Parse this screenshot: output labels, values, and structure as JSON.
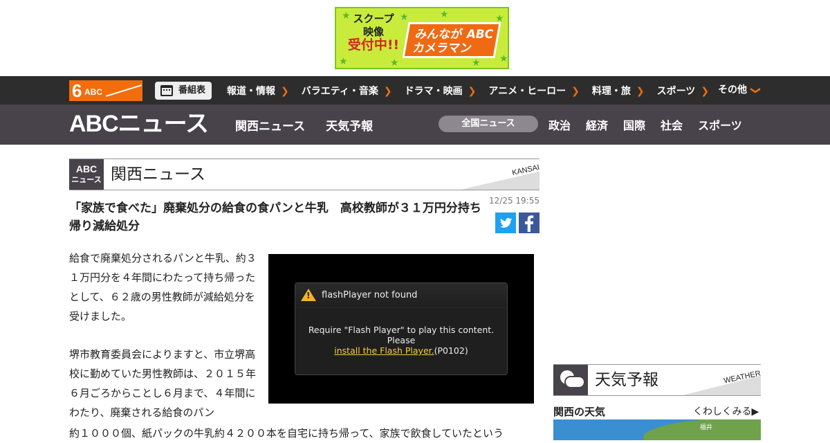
{
  "ad": {
    "left_lines": [
      "スクープ",
      "映像",
      "受付中!!"
    ],
    "logo_lines": [
      "みんなが ABC",
      "カメラマン"
    ],
    "colors": {
      "bg": "#c9ec3c",
      "logo": "#ef6a12"
    }
  },
  "topnav": {
    "logo_six": "6",
    "logo_text": "ABC",
    "program_guide": "番組表",
    "links": [
      "報道・情報",
      "バラエティ・音楽",
      "ドラマ・映画",
      "アニメ・ヒーロー",
      "料理・旅",
      "スポーツ"
    ],
    "more": "その他",
    "accent": "#f26d0c"
  },
  "sitebar": {
    "logo": "ABCニュース",
    "links": [
      "関西ニュース",
      "天気予報"
    ],
    "national": "全国ニュース",
    "categories": [
      "政治",
      "経済",
      "国際",
      "社会",
      "スポーツ"
    ]
  },
  "section": {
    "badge_top": "ABC",
    "badge_bottom": "ニュース",
    "title": "関西ニュース",
    "label": "KANSAI"
  },
  "article": {
    "title": "「家族で食べた」廃棄処分の給食の食パンと牛乳　高校教師が３１万円分持ち帰り減給処分",
    "timestamp": "12/25 19:55",
    "paragraphs": [
      "給食で廃棄処分されるパンと牛乳、約３１万円分を４年間にわたって持ち帰ったとして、６２歳の男性教師が減給処分を受けました。",
      "堺市教育委員会によりますと、市立堺高校に勤めていた男性教師は、２０１５年６月ごろからことし６月まで、４年間にわたり、廃棄される給食のパン"
    ],
    "wide_line": "約１０００個、紙パックの牛乳約４２００本を自宅に持ち帰って、家族で飲食していたという"
  },
  "video": {
    "error_title": "flashPlayer not found",
    "line1": "Require \"Flash Player\" to play this content.",
    "line2": "Please",
    "link": "install the Flash Player.",
    "code": "(P0102)"
  },
  "weather": {
    "title": "天気予報",
    "label": "WEATHER",
    "region": "関西の天気",
    "more": "くわしくみる▶",
    "map_label": "福井"
  }
}
